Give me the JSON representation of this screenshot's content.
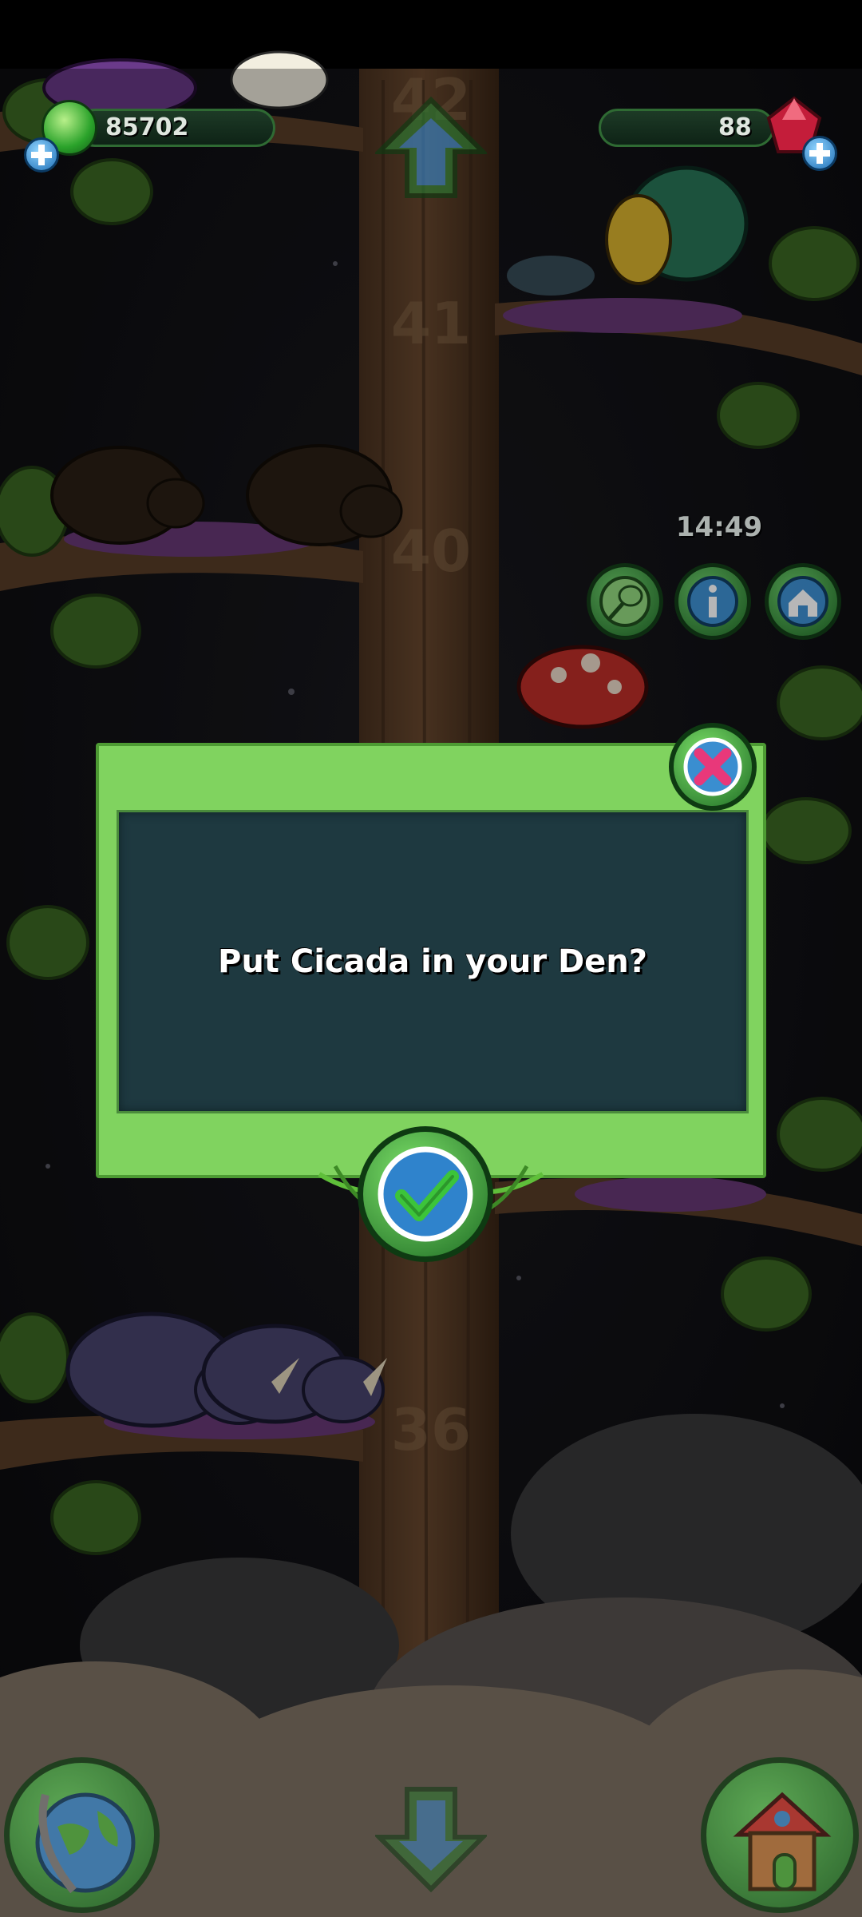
{
  "hud": {
    "coins": "85702",
    "gems": "88"
  },
  "timer": "14:49",
  "branch_numbers": [
    "42",
    "41",
    "40",
    "36"
  ],
  "dialog": {
    "message": "Put Cicada in your Den?"
  },
  "icons": {
    "coin": "green-coin-icon",
    "gem": "red-gem-icon",
    "add_coin": "plus-icon",
    "add_gem": "plus-icon",
    "up": "arrow-up-icon",
    "down": "arrow-down-icon",
    "net": "net-icon",
    "info": "info-icon",
    "den": "den-icon",
    "globe": "globe-icon",
    "house": "house-icon",
    "close": "close-icon",
    "confirm": "checkmark-icon"
  },
  "colors": {
    "panel": "#80d35f",
    "panel_inner": "#1e3940",
    "close_x": "#e8387a",
    "check": "#3cc43a"
  }
}
